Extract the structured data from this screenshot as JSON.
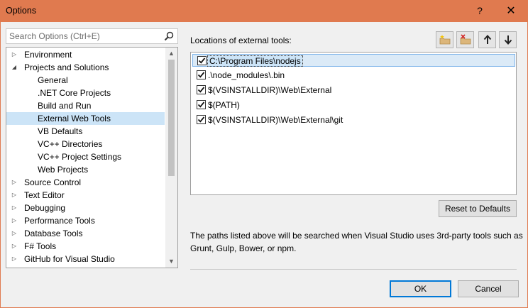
{
  "window": {
    "title": "Options",
    "help_glyph": "?",
    "close_glyph": "✕"
  },
  "search": {
    "placeholder": "Search Options (Ctrl+E)",
    "icon": "search-icon"
  },
  "tree": {
    "items": [
      {
        "label": "Environment",
        "level": 0,
        "expanded": false
      },
      {
        "label": "Projects and Solutions",
        "level": 0,
        "expanded": true
      },
      {
        "label": "General",
        "level": 1
      },
      {
        "label": ".NET Core Projects",
        "level": 1
      },
      {
        "label": "Build and Run",
        "level": 1
      },
      {
        "label": "External Web Tools",
        "level": 1,
        "selected": true
      },
      {
        "label": "VB Defaults",
        "level": 1
      },
      {
        "label": "VC++ Directories",
        "level": 1
      },
      {
        "label": "VC++ Project Settings",
        "level": 1
      },
      {
        "label": "Web Projects",
        "level": 1
      },
      {
        "label": "Source Control",
        "level": 0,
        "expanded": false
      },
      {
        "label": "Text Editor",
        "level": 0,
        "expanded": false
      },
      {
        "label": "Debugging",
        "level": 0,
        "expanded": false
      },
      {
        "label": "Performance Tools",
        "level": 0,
        "expanded": false
      },
      {
        "label": "Database Tools",
        "level": 0,
        "expanded": false
      },
      {
        "label": "F# Tools",
        "level": 0,
        "expanded": false
      },
      {
        "label": "GitHub for Visual Studio",
        "level": 0,
        "expanded": false
      }
    ]
  },
  "locations": {
    "label": "Locations of external tools:",
    "toolbar_icons": [
      "add-folder-icon",
      "remove-folder-icon",
      "move-up-icon",
      "move-down-icon"
    ],
    "items": [
      {
        "path": "C:\\Program Files\\nodejs",
        "checked": true,
        "selected": true
      },
      {
        "path": ".\\node_modules\\.bin",
        "checked": true
      },
      {
        "path": "$(VSINSTALLDIR)\\Web\\External",
        "checked": true
      },
      {
        "path": "$(PATH)",
        "checked": true
      },
      {
        "path": "$(VSINSTALLDIR)\\Web\\External\\git",
        "checked": true
      }
    ]
  },
  "reset_label": "Reset to Defaults",
  "description": "The paths listed above will be searched when Visual Studio uses 3rd-party tools such as Grunt, Gulp, Bower, or npm.",
  "ok_label": "OK",
  "cancel_label": "Cancel",
  "colors": {
    "titlebar": "#e07a4f",
    "selection": "#cce4f7",
    "default_button_border": "#0078d7"
  }
}
